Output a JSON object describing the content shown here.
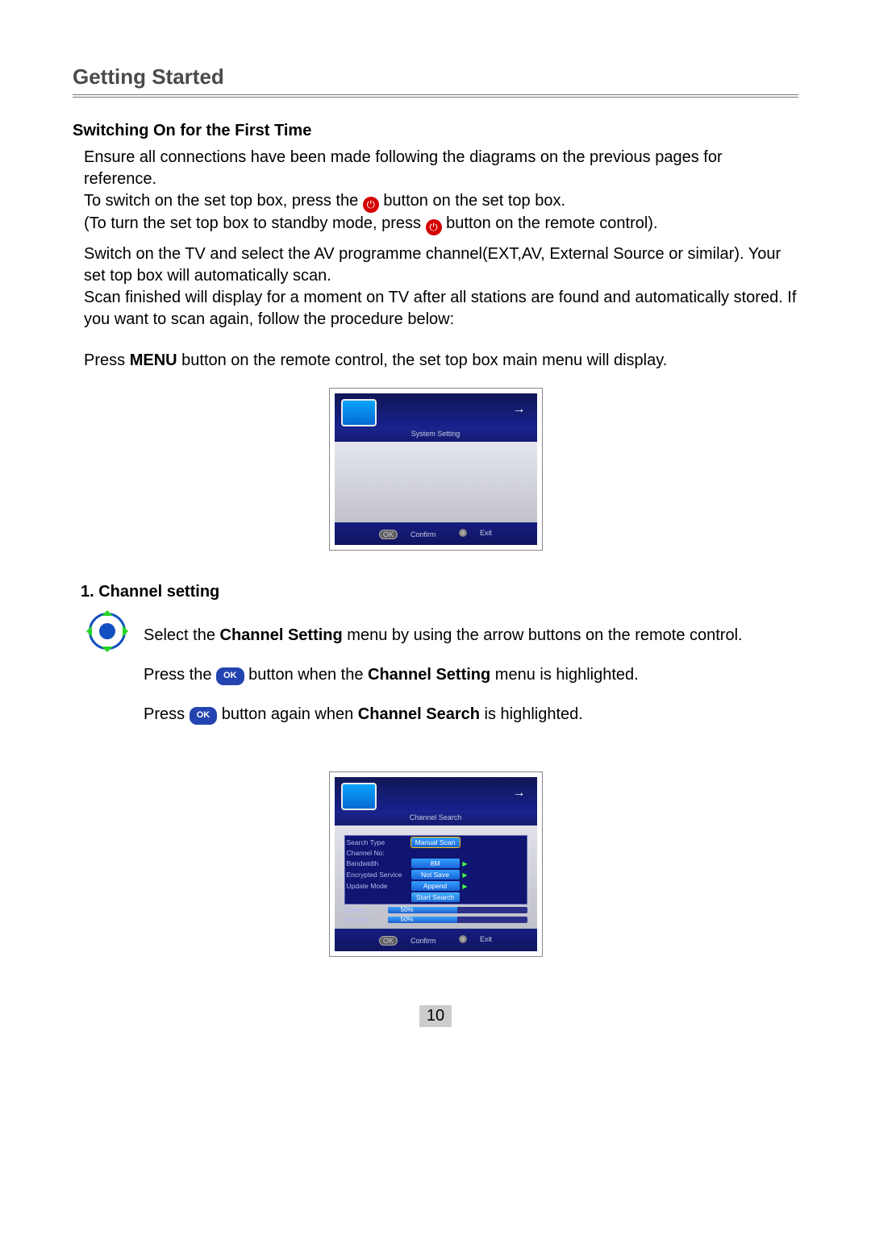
{
  "page": {
    "title": "Getting Started",
    "number": "10"
  },
  "sec1": {
    "heading": "Switching On for the First Time",
    "l1": "Ensure all connections have been made following the diagrams on the previous pages for reference.",
    "l2a": "To switch on the set top box, press the ",
    "l2b": " button on the set top box.",
    "l3a": "(To turn the set top box to standby mode, press ",
    "l3b": " button on the remote control).",
    "l4": "Switch on the TV and select the AV programme channel(EXT,AV, External Source or similar). Your set top box will automatically scan.",
    "l5": "Scan finished will display for a moment on TV after all stations are found and automatically stored. If you want to scan again, follow the procedure below:",
    "l6a": "Press ",
    "l6_menu": "MENU",
    "l6b": " button on the remote control, the set top box main menu will display."
  },
  "tv1": {
    "title": "System Setting",
    "confirm": "Confirm",
    "exit": "Exit",
    "ok": "OK"
  },
  "sec2": {
    "heading": "1. Channel setting",
    "l1a": "Select the ",
    "l1_bold": "Channel Setting",
    "l1b": "  menu by using the arrow buttons on the remote control.",
    "l2a": "Press the  ",
    "l2b": "   button when the ",
    "l2_bold": "Channel Setting",
    "l2c": " menu is highlighted.",
    "l3a": "Press  ",
    "l3b": "   button again when ",
    "l3_bold": "Channel Search",
    "l3c": " is highlighted.",
    "ok": "OK"
  },
  "tv2": {
    "title": "Channel Search",
    "rows": {
      "search_type": "Search Type",
      "search_type_val": "Manual Scan",
      "channel_no": "Channel No:",
      "bandwidth": "Bandwidth",
      "bandwidth_val": "8M",
      "encrypted": "Encrypted Service",
      "encrypted_val": "Not Save",
      "update": "Update Mode",
      "update_val": "Append",
      "start": "Start Search"
    },
    "quality": "Quality:",
    "strength": "Strength:",
    "quality_pct": "50%",
    "strength_pct": "50%",
    "confirm": "Confirm",
    "exit": "Exit",
    "ok": "OK"
  }
}
